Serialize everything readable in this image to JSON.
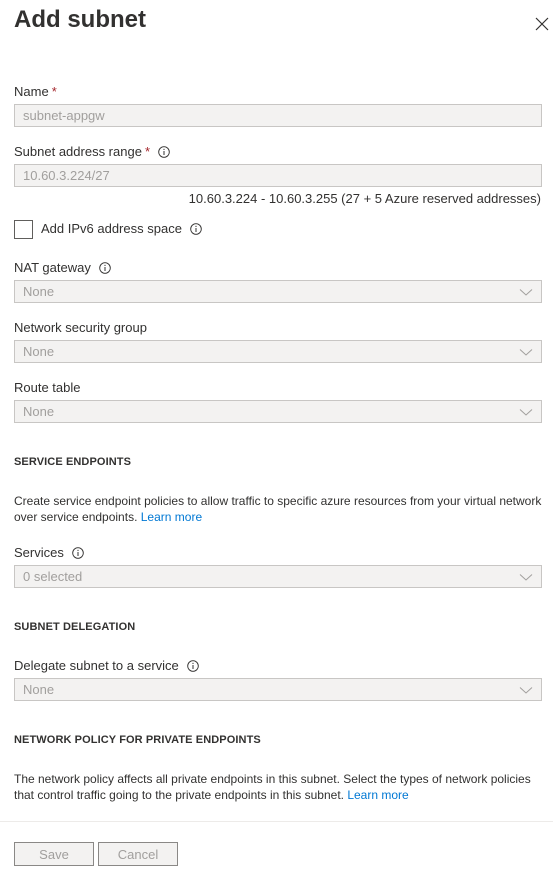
{
  "panel": {
    "title": "Add subnet"
  },
  "name": {
    "label": "Name",
    "value": "subnet-appgw"
  },
  "address_range": {
    "label": "Subnet address range",
    "value": "10.60.3.224/27",
    "hint": "10.60.3.224 - 10.60.3.255 (27 + 5 Azure reserved addresses)"
  },
  "ipv6": {
    "label": "Add IPv6 address space",
    "checked": false
  },
  "nat_gateway": {
    "label": "NAT gateway",
    "value": "None"
  },
  "nsg": {
    "label": "Network security group",
    "value": "None"
  },
  "route_table": {
    "label": "Route table",
    "value": "None"
  },
  "service_endpoints": {
    "heading": "SERVICE ENDPOINTS",
    "description": "Create service endpoint policies to allow traffic to specific azure resources from your virtual network over service endpoints.",
    "learn_more": "Learn more",
    "services_label": "Services",
    "services_value": "0 selected"
  },
  "delegation": {
    "heading": "SUBNET DELEGATION",
    "label": "Delegate subnet to a service",
    "value": "None"
  },
  "network_policy": {
    "heading": "NETWORK POLICY FOR PRIVATE ENDPOINTS",
    "description": "The network policy affects all private endpoints in this subnet. Select the types of network policies that control traffic going to the private endpoints in this subnet.",
    "learn_more": "Learn more"
  },
  "footer": {
    "save_label": "Save",
    "cancel_label": "Cancel"
  },
  "colors": {
    "accent": "#0078d4",
    "required": "#a4262c",
    "disabled_bg": "#f3f2f1"
  },
  "icons": {
    "close": "close-icon",
    "info": "info-icon",
    "chevron": "chevron-down-icon"
  }
}
